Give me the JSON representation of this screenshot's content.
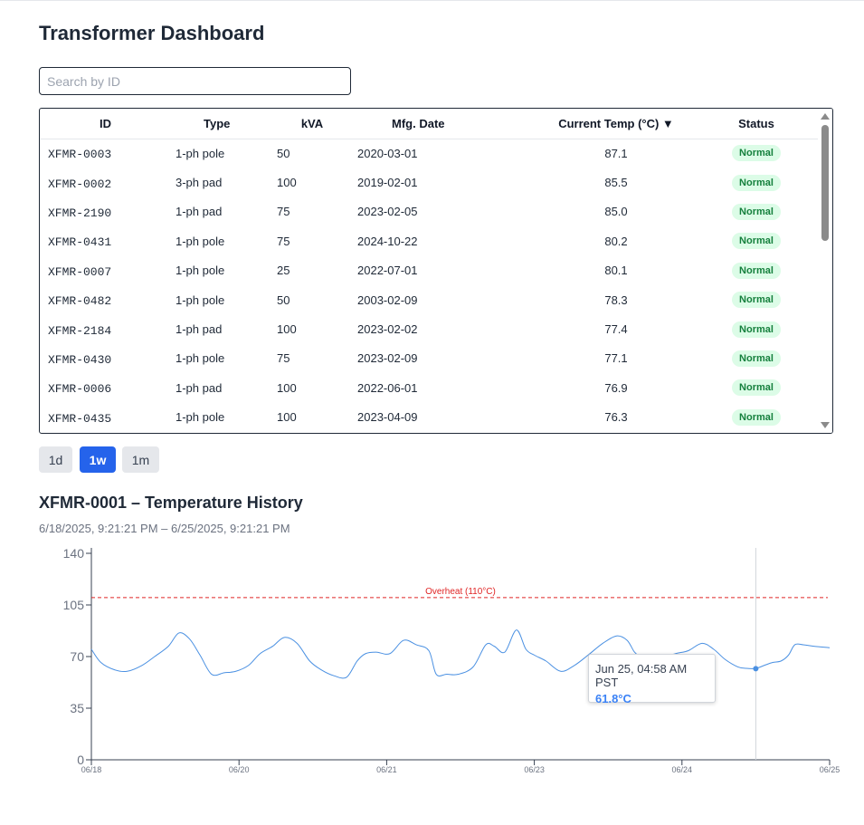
{
  "page": {
    "title": "Transformer Dashboard"
  },
  "search": {
    "placeholder": "Search by ID",
    "value": ""
  },
  "table": {
    "columns": [
      "ID",
      "Type",
      "kVA",
      "Mfg. Date",
      "Current Temp (°C) ▼",
      "Status"
    ],
    "rows": [
      {
        "id": "XFMR-0003",
        "type": "1-ph pole",
        "kva": "50",
        "mfg": "2020-03-01",
        "temp": "87.1",
        "status": "Normal"
      },
      {
        "id": "XFMR-0002",
        "type": "3-ph pad",
        "kva": "100",
        "mfg": "2019-02-01",
        "temp": "85.5",
        "status": "Normal"
      },
      {
        "id": "XFMR-2190",
        "type": "1-ph pad",
        "kva": "75",
        "mfg": "2023-02-05",
        "temp": "85.0",
        "status": "Normal"
      },
      {
        "id": "XFMR-0431",
        "type": "1-ph pole",
        "kva": "75",
        "mfg": "2024-10-22",
        "temp": "80.2",
        "status": "Normal"
      },
      {
        "id": "XFMR-0007",
        "type": "1-ph pole",
        "kva": "25",
        "mfg": "2022-07-01",
        "temp": "80.1",
        "status": "Normal"
      },
      {
        "id": "XFMR-0482",
        "type": "1-ph pole",
        "kva": "50",
        "mfg": "2003-02-09",
        "temp": "78.3",
        "status": "Normal"
      },
      {
        "id": "XFMR-2184",
        "type": "1-ph pad",
        "kva": "100",
        "mfg": "2023-02-02",
        "temp": "77.4",
        "status": "Normal"
      },
      {
        "id": "XFMR-0430",
        "type": "1-ph pole",
        "kva": "75",
        "mfg": "2023-02-09",
        "temp": "77.1",
        "status": "Normal"
      },
      {
        "id": "XFMR-0006",
        "type": "1-ph pad",
        "kva": "100",
        "mfg": "2022-06-01",
        "temp": "76.9",
        "status": "Normal"
      },
      {
        "id": "XFMR-0435",
        "type": "1-ph pole",
        "kva": "100",
        "mfg": "2023-04-09",
        "temp": "76.3",
        "status": "Normal"
      }
    ]
  },
  "range_buttons": [
    {
      "label": "1d",
      "active": false
    },
    {
      "label": "1w",
      "active": true
    },
    {
      "label": "1m",
      "active": false
    }
  ],
  "colors": {
    "accent": "#2563eb",
    "line": "#4a90e2",
    "threshold": "#e02424",
    "badge_bg": "#dcfce7",
    "badge_text": "#15803d"
  },
  "chart": {
    "title": "XFMR-0001 – Temperature History",
    "range_label": "6/18/2025, 9:21:21 PM – 6/25/2025, 9:21:21 PM",
    "threshold_label": "Overheat (110°C)",
    "tooltip": {
      "time": "Jun 25, 04:58 AM PST",
      "value": "61.8°C"
    }
  },
  "chart_data": {
    "type": "line",
    "title": "XFMR-0001 – Temperature History",
    "xlabel": "",
    "ylabel": "",
    "ylim": [
      0,
      140
    ],
    "yticks": [
      0,
      35,
      70,
      105,
      140
    ],
    "xlim": [
      0,
      7
    ],
    "xticks": [
      {
        "x": 0,
        "label": "06/18"
      },
      {
        "x": 1.4,
        "label": "06/20"
      },
      {
        "x": 2.8,
        "label": "06/21"
      },
      {
        "x": 4.2,
        "label": "06/23"
      },
      {
        "x": 5.6,
        "label": "06/24"
      },
      {
        "x": 7,
        "label": "06/25"
      }
    ],
    "threshold": 110,
    "hover_x": 6.3,
    "hover_y": 61.8,
    "grid": false,
    "series": [
      {
        "x": [
          0,
          0.09,
          0.22,
          0.34,
          0.48,
          0.6,
          0.73,
          0.83,
          0.93,
          1.03,
          1.14,
          1.26,
          1.37,
          1.49,
          1.6,
          1.72,
          1.83,
          1.95,
          2.07,
          2.18,
          2.3,
          2.42,
          2.52,
          2.6,
          2.7,
          2.83,
          2.96,
          3.08,
          3.2,
          3.27,
          3.37,
          3.48,
          3.62,
          3.74,
          3.82,
          3.92,
          4.03,
          4.12,
          4.2,
          4.31,
          4.45,
          4.58,
          4.71,
          4.85,
          4.98,
          5.08,
          5.15,
          5.21,
          5.3,
          5.4,
          5.54,
          5.66,
          5.79,
          5.9,
          6.01,
          6.13,
          6.21,
          6.3,
          6.38,
          6.46,
          6.54,
          6.61,
          6.67,
          6.75,
          6.85,
          7
        ],
        "y": [
          75,
          66,
          61,
          60,
          64,
          70,
          77,
          86,
          82,
          71,
          58,
          59,
          60,
          64,
          72,
          77,
          83,
          79,
          67,
          61,
          57,
          56,
          67,
          72,
          73,
          72,
          81,
          78,
          74,
          58,
          58,
          58,
          63,
          78,
          77,
          73,
          88,
          75,
          71,
          67,
          60,
          64,
          71,
          79,
          84,
          81,
          73,
          70,
          69,
          69,
          72,
          74,
          79,
          75,
          68,
          63,
          62,
          62,
          64,
          66,
          67,
          71,
          78,
          78,
          77,
          76
        ]
      }
    ]
  }
}
